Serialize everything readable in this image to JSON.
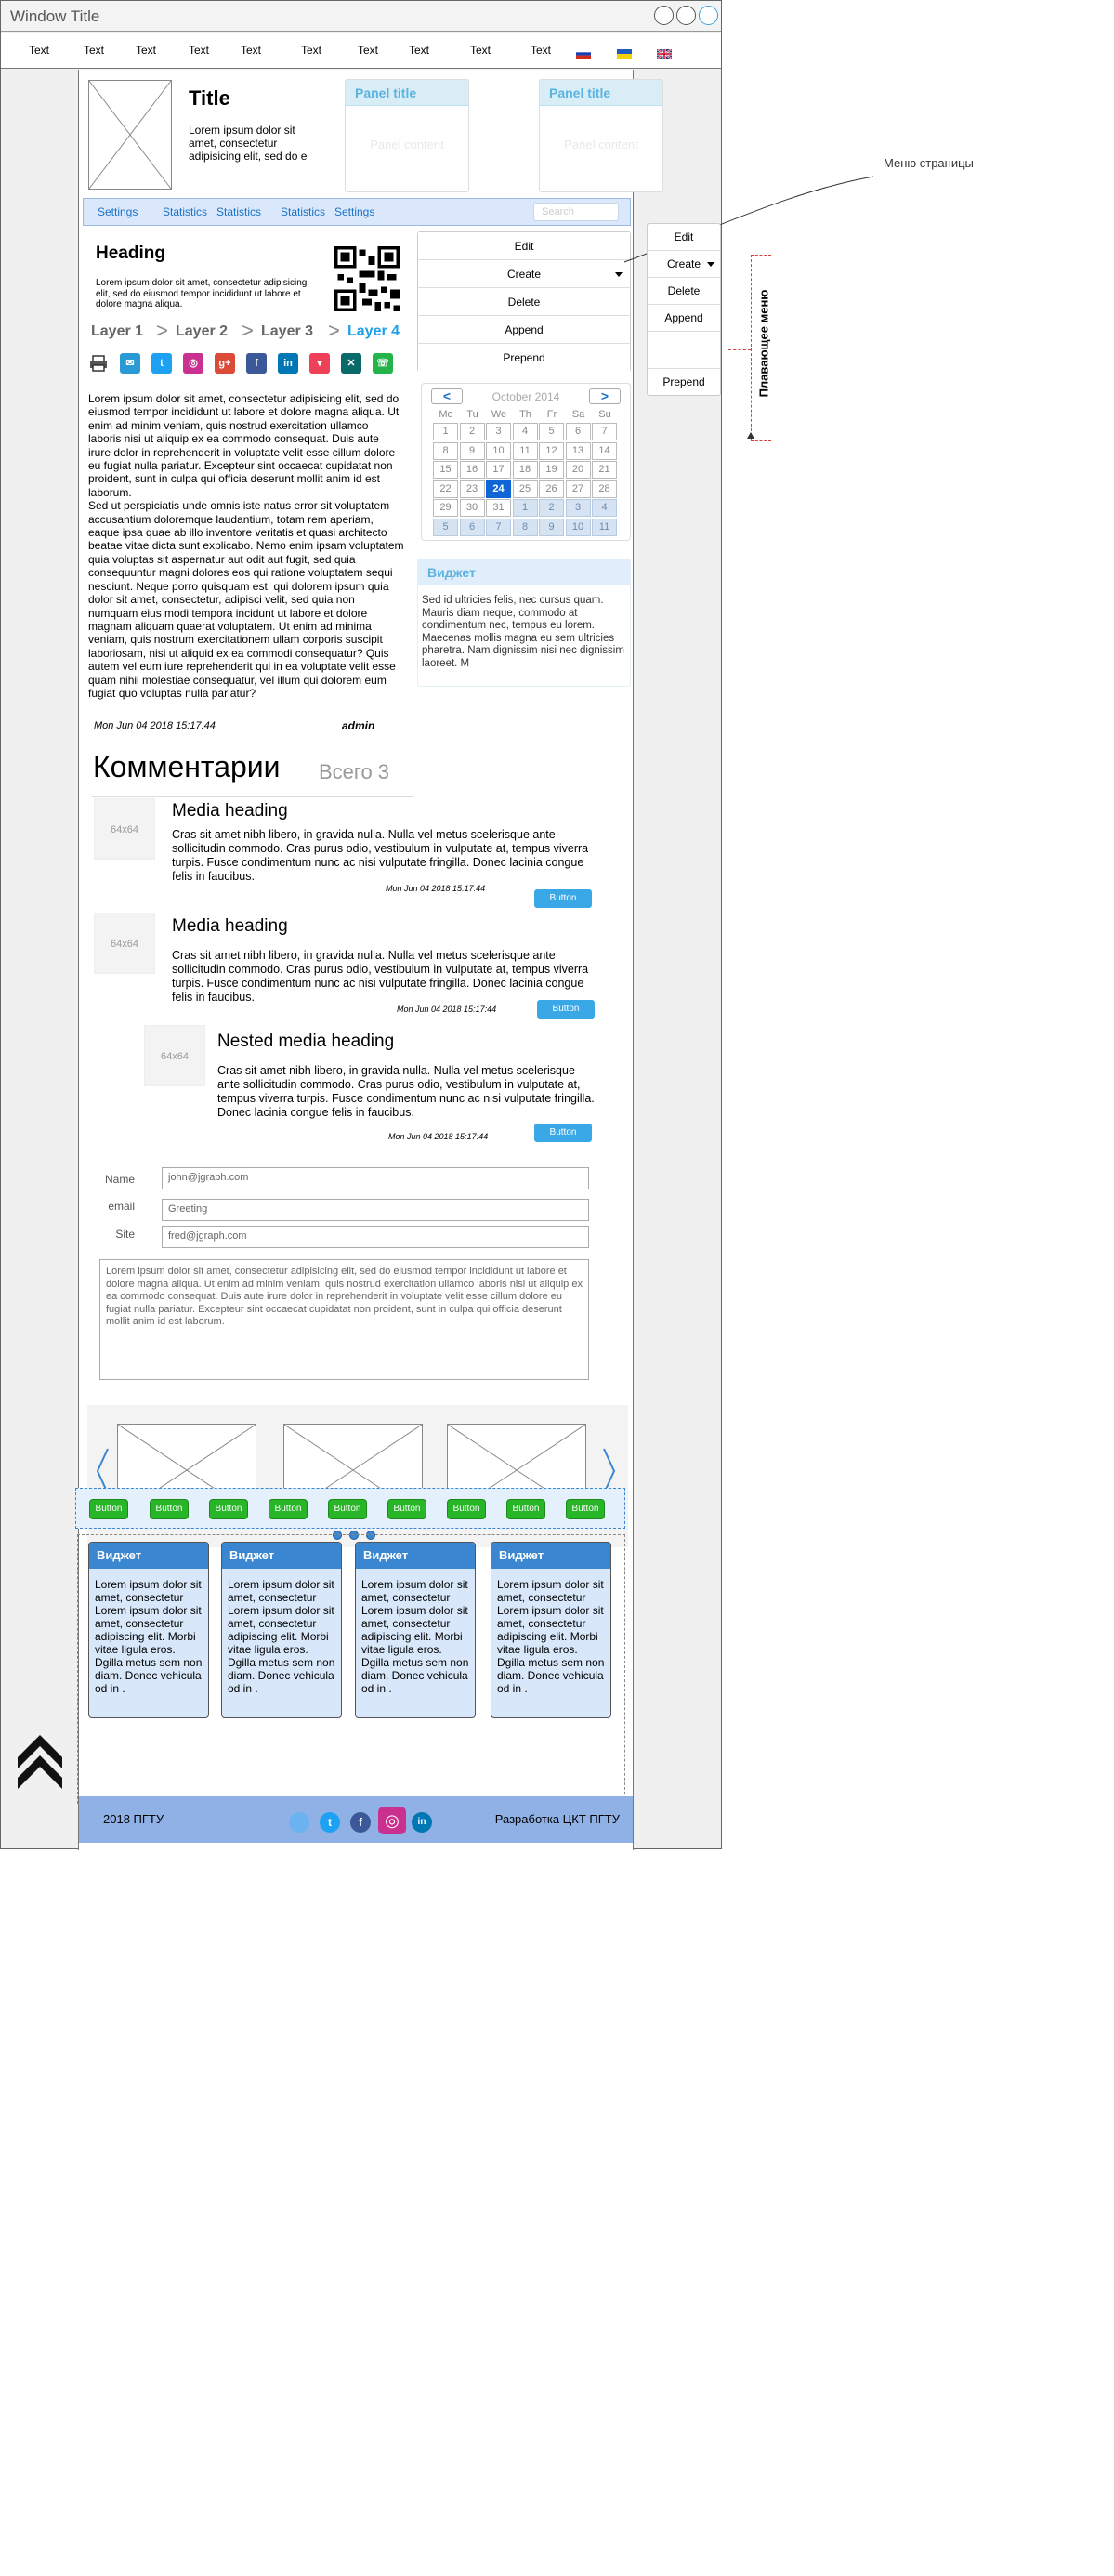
{
  "window": {
    "title": "Window Title"
  },
  "topnav": {
    "items": [
      "Text",
      "Text",
      "Text",
      "Text",
      "Text",
      "Text",
      "Text",
      "Text",
      "Text",
      "Text"
    ],
    "flags": [
      "ru",
      "ua",
      "gb"
    ]
  },
  "header": {
    "title": "Title",
    "text": "Lorem ipsum dolor sit amet, consectetur adipisicing elit, sed do e",
    "panels": [
      {
        "title": "Panel title",
        "content": "Panel content"
      },
      {
        "title": "Panel title",
        "content": "Panel content"
      }
    ]
  },
  "menubar": {
    "items": [
      "Settings",
      "Statistics",
      "Statistics",
      "Statistics",
      "Settings"
    ],
    "search_placeholder": "Search"
  },
  "article": {
    "heading": "Heading",
    "intro": "Lorem ipsum dolor sit amet, consectetur adipisicing elit, sed do eiusmod tempor incididunt ut labore et dolore magna aliqua.",
    "breadcrumb": [
      "Layer 1",
      "Layer 2",
      "Layer 3",
      "Layer 4"
    ],
    "breadcrumb_sep": ">",
    "body_p1": "Lorem ipsum dolor sit amet, consectetur adipisicing elit, sed do eiusmod tempor incididunt ut labore et dolore magna aliqua. Ut enim ad minim veniam, quis nostrud exercitation ullamco laboris nisi ut aliquip ex ea commodo consequat. Duis aute irure dolor in reprehenderit in voluptate velit esse cillum dolore eu fugiat nulla pariatur. Excepteur sint occaecat cupidatat non proident, sunt in culpa qui officia deserunt mollit anim id est laborum.",
    "body_p2": "Sed ut perspiciatis unde omnis iste natus error sit voluptatem accusantium doloremque laudantium, totam rem aperiam, eaque ipsa quae ab illo inventore veritatis et quasi architecto beatae vitae dicta sunt explicabo. Nemo enim ipsam voluptatem quia voluptas sit aspernatur aut odit aut fugit, sed quia consequuntur magni dolores eos qui ratione voluptatem sequi nesciunt. Neque porro quisquam est, qui dolorem ipsum quia dolor sit amet, consectetur, adipisci velit, sed quia non numquam eius modi tempora incidunt ut labore et dolore magnam aliquam quaerat voluptatem. Ut enim ad minima veniam, quis nostrum exercitationem ullam corporis suscipit laboriosam, nisi ut aliquid ex ea commodi consequatur? Quis autem vel eum iure reprehenderit qui in ea voluptate velit esse quam nihil molestiae consequatur, vel illum qui dolorem eum fugiat quo voluptas nulla pariatur?",
    "date": "Mon Jun 04 2018 15:17:44",
    "author": "admin"
  },
  "side_menu": {
    "items": [
      "Edit",
      "Create",
      "Delete",
      "Append",
      "Prepend"
    ]
  },
  "calendar": {
    "prev": "<",
    "next": ">",
    "month": "October 2014",
    "days": [
      "Mo",
      "Tu",
      "We",
      "Th",
      "Fr",
      "Sa",
      "Su"
    ],
    "cells": [
      "1",
      "2",
      "3",
      "4",
      "5",
      "6",
      "7",
      "8",
      "9",
      "10",
      "11",
      "12",
      "13",
      "14",
      "15",
      "16",
      "17",
      "18",
      "19",
      "20",
      "21",
      "22",
      "23",
      "24",
      "25",
      "26",
      "27",
      "28",
      "29",
      "30",
      "31",
      "1",
      "2",
      "3",
      "4",
      "5",
      "6",
      "7",
      "8",
      "9",
      "10",
      "11"
    ],
    "today": "24"
  },
  "side_widget": {
    "title": "Виджет",
    "text": "Sed id ultricies felis, nec cursus quam. Mauris diam neque, commodo at condimentum nec, tempus eu lorem. Maecenas mollis magna eu sem ultricies pharetra. Nam dignissim nisi nec dignissim laoreet. M"
  },
  "comments": {
    "title": "Комментарии",
    "count": "Всего 3",
    "items": [
      {
        "img": "64x64",
        "heading": "Media heading",
        "text": "Cras sit amet nibh libero, in gravida nulla. Nulla vel metus scelerisque ante sollicitudin commodo. Cras purus odio, vestibulum in vulputate at, tempus viverra turpis. Fusce condimentum nunc ac nisi vulputate fringilla. Donec lacinia congue felis in faucibus.",
        "date": "Mon Jun 04 2018 15:17:44",
        "button": "Button"
      },
      {
        "img": "64x64",
        "heading": "Media heading",
        "text": "Cras sit amet nibh libero, in gravida nulla. Nulla vel metus scelerisque ante sollicitudin commodo. Cras purus odio, vestibulum in vulputate at, tempus viverra turpis. Fusce condimentum nunc ac nisi vulputate fringilla. Donec lacinia congue felis in faucibus.",
        "date": "Mon Jun 04 2018 15:17:44",
        "button": "Button"
      },
      {
        "img": "64x64",
        "heading": "Nested media heading",
        "text": "Cras sit amet nibh libero, in gravida nulla. Nulla vel metus scelerisque ante sollicitudin commodo. Cras purus odio, vestibulum in vulputate at, tempus viverra turpis. Fusce condimentum nunc ac nisi vulputate fringilla. Donec lacinia congue felis in faucibus.",
        "date": "Mon Jun 04 2018 15:17:44",
        "button": "Button"
      }
    ]
  },
  "form": {
    "name_label": "Name",
    "name_value": "john@jgraph.com",
    "email_label": "email",
    "email_value": "Greeting",
    "site_label": "Site",
    "site_value": "fred@jgraph.com",
    "message": "Lorem ipsum dolor sit amet, consectetur adipisicing elit, sed do eiusmod tempor incididunt ut labore et dolore magna aliqua. Ut enim ad minim veniam, quis nostrud exercitation ullamco laboris nisi ut aliquip ex ea commodo consequat. Duis aute irure dolor in reprehenderit in voluptate velit esse cillum dolore eu fugiat nulla pariatur. Excepteur sint occaecat cupidatat non proident, sunt in culpa qui officia deserunt mollit anim id est laborum."
  },
  "carousel": {
    "prev_icon": "chevron-left-icon",
    "next_icon": "chevron-right-icon",
    "slides": 3
  },
  "green_buttons": [
    "Button",
    "Button",
    "Button",
    "Button",
    "Button",
    "Button",
    "Button",
    "Button",
    "Button"
  ],
  "widgets": [
    {
      "title": "Виджет",
      "text": "Lorem ipsum dolor sit amet, consectetur Lorem ipsum dolor sit amet, consectetur adipiscing elit. Morbi vitae ligula eros. Dgilla metus sem non diam. Donec vehicula od in ."
    },
    {
      "title": "Виджет",
      "text": "Lorem ipsum dolor sit amet, consectetur Lorem ipsum dolor sit amet, consectetur adipiscing elit. Morbi vitae ligula eros. Dgilla metus sem non diam. Donec vehicula od in ."
    },
    {
      "title": "Виджет",
      "text": "Lorem ipsum dolor sit amet, consectetur Lorem ipsum dolor sit amet, consectetur adipiscing elit. Morbi vitae ligula eros. Dgilla metus sem non diam. Donec vehicula od in ."
    },
    {
      "title": "Виджет",
      "text": "Lorem ipsum dolor sit amet, consectetur Lorem ipsum dolor sit amet, consectetur adipiscing elit. Morbi vitae ligula eros. Dgilla metus sem non diam. Donec vehicula od in ."
    }
  ],
  "footer": {
    "left": "2018 ПГТУ",
    "right": "Разработка ЦКТ ПГТУ"
  },
  "annotations": {
    "page_menu": "Меню страницы",
    "floating_menu": "Плавающее меню"
  },
  "floating_menu": {
    "items": [
      "Edit",
      "Create",
      "Delete",
      "Append",
      "",
      "Prepend"
    ]
  },
  "colors": {
    "accent": "#1ea0e8",
    "menubar": "#dbe8fb",
    "footer": "#8fb1e6",
    "green": "#28b528",
    "widget_header": "#3a86d0"
  }
}
